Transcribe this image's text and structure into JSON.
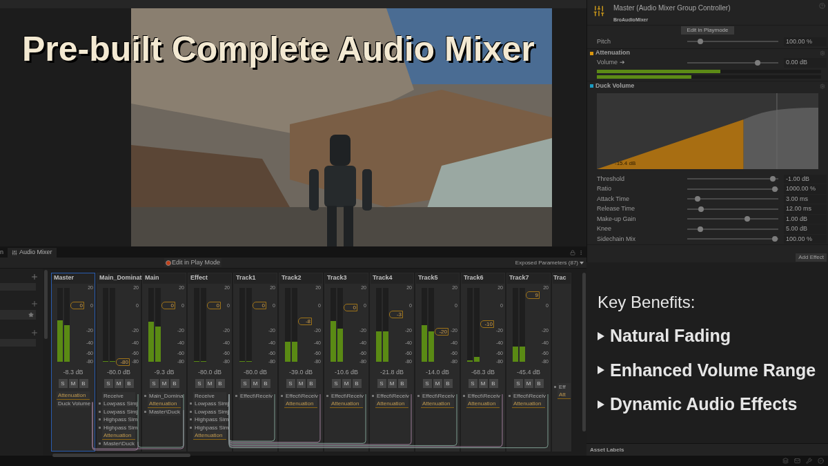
{
  "title": "Pre-built Complete Audio Mixer",
  "mixer_window": {
    "tabs": [
      {
        "label": "n",
        "selected": false
      },
      {
        "label": "Audio Mixer",
        "selected": true
      }
    ],
    "edit_button": "Edit in Play Mode",
    "exposed_parameters": "Exposed Parameters (87)",
    "groups": [
      {
        "name": "Master",
        "selected": true,
        "kind": "full",
        "meters": [
          {
            "level": 0.56
          },
          {
            "level": 0.5
          }
        ],
        "fader": {
          "label": "0",
          "level": 0.76
        },
        "scale": [
          "20",
          "0",
          "-20",
          "-40",
          "-60",
          "-80"
        ],
        "reading": "-8.3 dB",
        "buttons": [
          "S",
          "M",
          "B"
        ],
        "slots": [
          {
            "label": "Attenuation",
            "kind": "attenuation"
          },
          {
            "label": "Duck Volume",
            "kind": "plain"
          }
        ]
      },
      {
        "name": "Main_Dominat",
        "selected": false,
        "kind": "full",
        "meters": [
          {
            "level": 0.01
          },
          {
            "level": 0.01
          }
        ],
        "fader": {
          "label": "-80",
          "level": 0.0
        },
        "scale": [
          "20",
          "0",
          "-20",
          "-40",
          "-60",
          "-80"
        ],
        "reading": "-80.0 dB",
        "buttons": [
          "S",
          "M",
          "B"
        ],
        "slots": [
          {
            "label": "Receive",
            "kind": "plain"
          },
          {
            "label": "Lowpass Simj",
            "kind": "effect"
          },
          {
            "label": "Lowpass Simj",
            "kind": "effect"
          },
          {
            "label": "Highpass Sim",
            "kind": "effect"
          },
          {
            "label": "Highpass Sim",
            "kind": "effect"
          },
          {
            "label": "Attenuation",
            "kind": "attenuation"
          },
          {
            "label": "Master\\Duck",
            "kind": "effect"
          }
        ]
      },
      {
        "name": "Main",
        "selected": false,
        "kind": "full",
        "meters": [
          {
            "level": 0.54
          },
          {
            "level": 0.48
          }
        ],
        "fader": {
          "label": "0",
          "level": 0.76
        },
        "scale": [
          "20",
          "0",
          "-20",
          "-40",
          "-60",
          "-80"
        ],
        "reading": "-9.3 dB",
        "buttons": [
          "S",
          "M",
          "B"
        ],
        "slots": [
          {
            "label": "Main_Domina",
            "kind": "effect"
          },
          {
            "label": "Attenuation",
            "kind": "attenuation"
          },
          {
            "label": "Master\\Duck",
            "kind": "effect"
          }
        ]
      },
      {
        "name": "Effect",
        "selected": false,
        "kind": "full",
        "meters": [
          {
            "level": 0.01
          },
          {
            "level": 0.01
          }
        ],
        "fader": {
          "label": "0",
          "level": 0.76
        },
        "scale": [
          "20",
          "0",
          "-20",
          "-40",
          "-60",
          "-80"
        ],
        "reading": "-80.0 dB",
        "buttons": [
          "S",
          "M",
          "B"
        ],
        "slots": [
          {
            "label": "Receive",
            "kind": "plain"
          },
          {
            "label": "Lowpass Simj",
            "kind": "effect"
          },
          {
            "label": "Lowpass Simj",
            "kind": "effect"
          },
          {
            "label": "Highpass Sim",
            "kind": "effect"
          },
          {
            "label": "Highpass Sim",
            "kind": "effect"
          },
          {
            "label": "Attenuation",
            "kind": "attenuation"
          }
        ]
      },
      {
        "name": "Track1",
        "selected": false,
        "kind": "full",
        "meters": [
          {
            "level": 0.01
          },
          {
            "level": 0.01
          }
        ],
        "fader": {
          "label": "0",
          "level": 0.76
        },
        "scale": [
          "20",
          "0",
          "-20",
          "-40",
          "-60",
          "-80"
        ],
        "reading": "-80.0 dB",
        "buttons": [
          "S",
          "M",
          "B"
        ],
        "slots": [
          {
            "label": "Effect\\Receiv",
            "kind": "effect"
          }
        ]
      },
      {
        "name": "Track2",
        "selected": false,
        "kind": "full",
        "meters": [
          {
            "level": 0.27
          },
          {
            "level": 0.27
          }
        ],
        "fader": {
          "label": "-8",
          "level": 0.55
        },
        "scale": [
          "20",
          "0",
          "-20",
          "-40",
          "-60",
          "-80"
        ],
        "reading": "-39.0 dB",
        "buttons": [
          "S",
          "M",
          "B"
        ],
        "slots": [
          {
            "label": "Effect\\Receiv",
            "kind": "effect"
          },
          {
            "label": "Attenuation",
            "kind": "attenuation"
          }
        ]
      },
      {
        "name": "Track3",
        "selected": false,
        "kind": "full",
        "meters": [
          {
            "level": 0.55
          },
          {
            "level": 0.45
          }
        ],
        "fader": {
          "label": "0",
          "level": 0.73
        },
        "scale": [
          "20",
          "0",
          "-20",
          "-40",
          "-60",
          "-80"
        ],
        "reading": "-10.6 dB",
        "buttons": [
          "S",
          "M",
          "B"
        ],
        "slots": [
          {
            "label": "Effect\\Receiv",
            "kind": "effect"
          },
          {
            "label": "Attenuation",
            "kind": "attenuation"
          }
        ]
      },
      {
        "name": "Track4",
        "selected": false,
        "kind": "full",
        "meters": [
          {
            "level": 0.41
          },
          {
            "level": 0.41
          }
        ],
        "fader": {
          "label": "-3",
          "level": 0.64
        },
        "scale": [
          "20",
          "0",
          "-20",
          "-40",
          "-60",
          "-80"
        ],
        "reading": "-21.8 dB",
        "buttons": [
          "S",
          "M",
          "B"
        ],
        "slots": [
          {
            "label": "Effect\\Receiv",
            "kind": "effect"
          },
          {
            "label": "Attenuation",
            "kind": "attenuation"
          }
        ]
      },
      {
        "name": "Track5",
        "selected": false,
        "kind": "full",
        "meters": [
          {
            "level": 0.5
          },
          {
            "level": 0.41
          }
        ],
        "fader": {
          "label": "-20",
          "level": 0.41
        },
        "scale": [
          "20",
          "0",
          "-20",
          "-40",
          "-60",
          "-80"
        ],
        "reading": "-14.0 dB",
        "buttons": [
          "S",
          "M",
          "B"
        ],
        "slots": [
          {
            "label": "Effect\\Receiv",
            "kind": "effect"
          },
          {
            "label": "Attenuation",
            "kind": "attenuation"
          }
        ]
      },
      {
        "name": "Track6",
        "selected": false,
        "kind": "full",
        "meters": [
          {
            "level": 0.02
          },
          {
            "level": 0.07
          }
        ],
        "fader": {
          "label": "-10",
          "level": 0.51
        },
        "scale": [
          "20",
          "0",
          "-20",
          "-40",
          "-60",
          "-80"
        ],
        "reading": "-68.3 dB",
        "buttons": [
          "S",
          "M",
          "B"
        ],
        "slots": [
          {
            "label": "Effect\\Receiv",
            "kind": "effect"
          },
          {
            "label": "Attenuation",
            "kind": "attenuation"
          }
        ]
      },
      {
        "name": "Track7",
        "selected": false,
        "kind": "full",
        "meters": [
          {
            "level": 0.21
          },
          {
            "level": 0.21
          }
        ],
        "fader": {
          "label": "9",
          "level": 0.9
        },
        "scale": [
          "20",
          "0",
          "-20",
          "-40",
          "-60",
          "-80"
        ],
        "reading": "-45.4 dB",
        "buttons": [
          "S",
          "M",
          "B"
        ],
        "slots": [
          {
            "label": "Effect\\Receiv",
            "kind": "effect"
          },
          {
            "label": "Attenuation",
            "kind": "attenuation"
          }
        ]
      },
      {
        "name": "Trac",
        "selected": false,
        "kind": "cut",
        "slots": [
          {
            "label": "Eff",
            "kind": "effect"
          },
          {
            "label": "Att",
            "kind": "attenuation"
          }
        ]
      }
    ]
  },
  "inspector": {
    "title": "Master (Audio Mixer Group Controller)",
    "subtitle": "BroAudioMixer",
    "edit_button": "Edit in Playmode",
    "pitch": {
      "label": "Pitch",
      "level": 0.12,
      "value": "100.00 %"
    },
    "sections": [
      {
        "title": "Attenuation",
        "color": "#d9960f"
      },
      {
        "title": "Duck Volume",
        "color": "#1a9bc2"
      }
    ],
    "volume": {
      "label": "Volume ➔",
      "level": 0.79,
      "value": "0.00 dB"
    },
    "volume_meters": [
      {
        "level": 0.55
      },
      {
        "level": 0.42
      }
    ],
    "graph_label": "-15.4 dB",
    "params": [
      {
        "label": "Threshold",
        "level": 0.97,
        "value": "-1.00 dB"
      },
      {
        "label": "Ratio",
        "level": 0.99,
        "value": "1000.00 %"
      },
      {
        "label": "Attack Time",
        "level": 0.09,
        "value": "3.00 ms"
      },
      {
        "label": "Release Time",
        "level": 0.13,
        "value": "12.00 ms"
      },
      {
        "label": "Make-up Gain",
        "level": 0.67,
        "value": "1.00 dB"
      },
      {
        "label": "Knee",
        "level": 0.12,
        "value": "5.00 dB"
      },
      {
        "label": "Sidechain Mix",
        "level": 0.99,
        "value": "100.00 %"
      }
    ],
    "add_effect": "Add Effect"
  },
  "benefits": {
    "heading": "Key Benefits:",
    "items": [
      "Natural Fading",
      "Enhanced Volume Range",
      "Dynamic Audio Effects"
    ]
  },
  "asset_labels": "Asset Labels"
}
